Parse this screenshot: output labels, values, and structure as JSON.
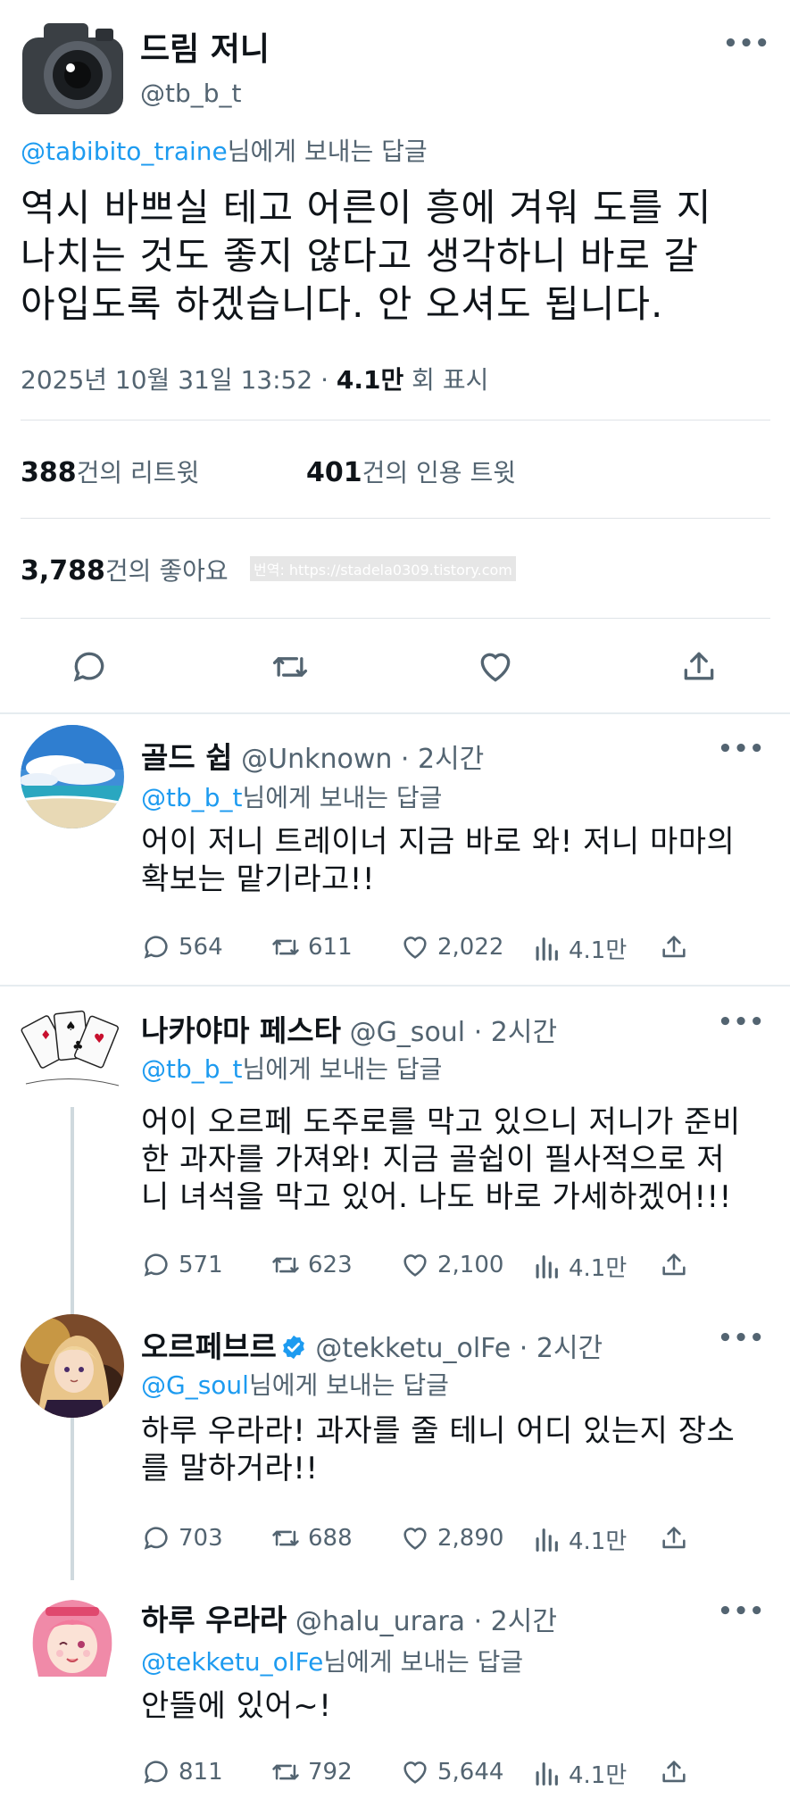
{
  "main_tweet": {
    "name": "드림 저니",
    "handle": "@tb_b_t",
    "reply_to_handle": "@tabibito_traine",
    "reply_suffix": "님에게 보내는 답글",
    "text_lines": [
      "역시 바쁘실 테고 어른이 흥에 겨워 도를 지",
      "나치는 것도 좋지 않다고 생각하니 바로 갈",
      "아입도록 하겠습니다. 안 오셔도 됩니다."
    ],
    "date": "2025년 10월 31일  13:52 · ",
    "views_number": "4.1만",
    "views_label": " 회 표시",
    "retweets_count": "388",
    "retweets_label": "건의 리트윗",
    "quotes_count": "401",
    "quotes_label": "건의 인용 트윗",
    "likes_count": "3,788",
    "likes_label": "건의 좋아요",
    "watermark": "번역: https://stadela0309.tistory.com"
  },
  "replies": [
    {
      "name": "골드 쉽",
      "handle": "@Unknown",
      "time": " · 2시간",
      "reply_to_handle": "@tb_b_t",
      "reply_suffix": "님에게 보내는 답글",
      "text_lines": [
        "어이 저니 트레이너 지금 바로 와! 저니 마마의",
        "확보는 맡기라고!!"
      ],
      "comments": "564",
      "retweets": "611",
      "likes": "2,022",
      "views": "4.1만"
    },
    {
      "name": "나카야마 페스타",
      "handle": "@G_soul",
      "time": " · 2시간",
      "reply_to_handle": "@tb_b_t",
      "reply_suffix": "님에게 보내는 답글",
      "text_lines": [
        "어이 오르페 도주로를 막고 있으니 저니가 준비",
        "한 과자를 가져와! 지금 골쉽이 필사적으로 저",
        "니 녀석을 막고 있어. 나도 바로 가세하겠어!!!"
      ],
      "comments": "571",
      "retweets": "623",
      "likes": "2,100",
      "views": "4.1만"
    },
    {
      "name": "오르페브르",
      "handle": "@tekketu_olFe",
      "time": " · 2시간",
      "reply_to_handle": "@G_soul",
      "reply_suffix": "님에게 보내는 답글",
      "text_lines": [
        "하루 우라라! 과자를 줄 테니 어디 있는지 장소",
        "를 말하거라!!"
      ],
      "comments": "703",
      "retweets": "688",
      "likes": "2,890",
      "views": "4.1만"
    },
    {
      "name": "하루 우라라",
      "handle": "@halu_urara",
      "time": " · 2시간",
      "reply_to_handle": "@tekketu_olFe",
      "reply_suffix": "님에게 보내는 답글",
      "text_lines": [
        "안뜰에 있어~!"
      ],
      "comments": "811",
      "retweets": "792",
      "likes": "5,644",
      "views": "4.1만"
    }
  ],
  "icons": {
    "reply": "speech-bubble-icon",
    "retweet": "retweet-arrows-icon",
    "like": "heart-icon",
    "views": "bar-chart-icon",
    "share": "share-upload-icon",
    "more": "more-dots-icon",
    "verified": "verified-badge-icon"
  },
  "colors": {
    "accent": "#1d9bf0",
    "secondary_text": "#536471",
    "primary_text": "#0f1419"
  },
  "more_label": "•••"
}
